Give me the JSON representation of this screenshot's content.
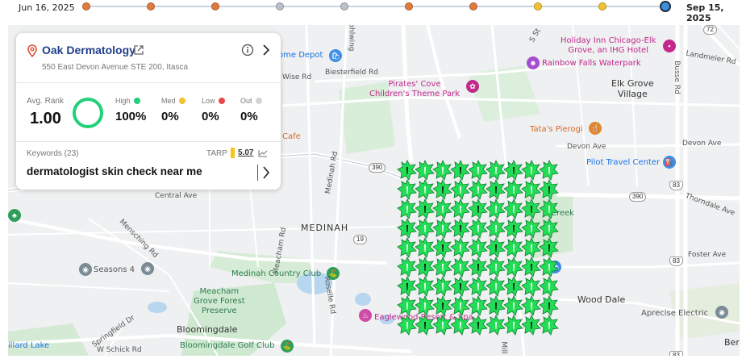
{
  "timeline": {
    "start_date": "Jun 16, 2025",
    "end_date": "Sep 15, 2025",
    "points": [
      {
        "color": "#e07b3a"
      },
      {
        "color": "#e07b3a"
      },
      {
        "color": "#e07b3a"
      },
      {
        "color": "#b9c2cc"
      },
      {
        "color": "#b9c2cc"
      },
      {
        "color": "#e07b3a"
      },
      {
        "color": "#e07b3a"
      },
      {
        "color": "#f2c230"
      },
      {
        "color": "#f2c230"
      },
      {
        "color": "#3f8fd9"
      }
    ]
  },
  "business": {
    "name": "Oak Dermatology",
    "address": "550 East Devon Avenue STE 200, Itasca"
  },
  "stats": {
    "avg_rank_label": "Avg. Rank",
    "avg_rank_value": "1.00",
    "high": {
      "label": "High",
      "value": "100%",
      "color": "#21d07a"
    },
    "med": {
      "label": "Med",
      "value": "0%",
      "color": "#f2c230"
    },
    "low": {
      "label": "Low",
      "value": "0%",
      "color": "#e84848"
    },
    "out": {
      "label": "Out",
      "value": "0%",
      "color": "#d4d4d4"
    }
  },
  "keywords": {
    "count_label": "Keywords (23)",
    "tarp_label": "TARP",
    "tarp_value": "5.07",
    "current": "dermatologist skin check near me"
  },
  "map": {
    "labels": {
      "home_depot": "ome Depot",
      "wise_rd": "Wise Rd",
      "biesterfield_rd": "Biesterfield Rd",
      "pirates_cove": "Pirates' Cove\nChildren's Theme Park",
      "holiday_inn": "Holiday Inn Chicago-Elk\nGrove, an IHG Hotel",
      "rainbow_falls": "Rainbow Falls Waterpark",
      "landmeier_rd": "Landmeier Rd",
      "elk_grove": "Elk Grove\nVillage",
      "busse_rd": "Busse Rd",
      "tatas_pierogi": "Tata's Pierogi",
      "devon_ave_1": "Devon Ave",
      "devon_ave_2": "Devon Ave",
      "pilot_travel": "Pilot Travel Center",
      "cafe": "Cafe",
      "medinah_rd": "Medinah Rd",
      "central_ave": "Central Ave",
      "thorndale_ave": "Thorndale Ave",
      "creek": "Creek",
      "medinah": "MEDINAH",
      "meacham_rd": "Meacham Rd",
      "mensching_rd": "Mensching Rd",
      "seasons_4": "Seasons 4",
      "medinah_cc": "Medinah Country Club",
      "meacham_grove": "Meacham\nGrove Forest\nPreserve",
      "roselle_rd": "Roselle Rd",
      "foster_ave": "Foster Ave",
      "wood_dale": "Wood Dale",
      "aprecise": "Aprecise Electric",
      "springfield_dr": "Springfield Dr",
      "bloomingdale": "Bloomingdale",
      "eaglewood": "Eaglewood Resort & Spa",
      "bloomingdale_golf": "Bloomingdale Golf Club",
      "w_schick_rd": "W Schick Rd",
      "illard_lake": "illard Lake",
      "ber": "Ber",
      "rohlwing": "ohlwing",
      "s_st": "S St",
      "mill": "Mill",
      "r390a": "390",
      "r390b": "390",
      "r19": "19",
      "r83a": "83",
      "r83b": "83",
      "r83c": "83",
      "r72": "72"
    }
  }
}
